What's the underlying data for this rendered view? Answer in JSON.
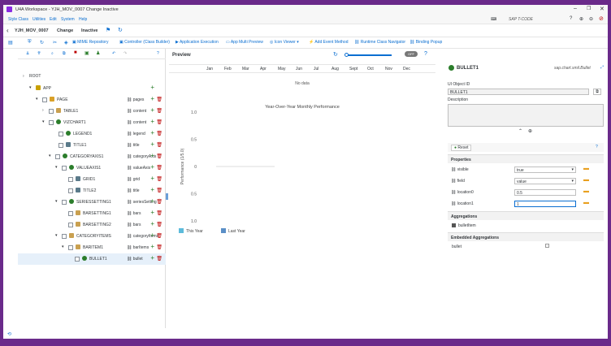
{
  "app": {
    "title": "U4A Workspace - YJH_MOV_0007 Change Inactive"
  },
  "menu": [
    "Style Class",
    "Utilities",
    "Edit",
    "System",
    "Help"
  ],
  "tcode": {
    "label": "SAP T-CODE"
  },
  "header": {
    "app_id": "YJH_MOV_0007",
    "mode": "Change",
    "status": "Inactive"
  },
  "toolbar": {
    "mime": "MIME Repository",
    "controller": "Controller (Class Builder)",
    "app_exec": "Application Execution",
    "multi": "App Multi Preview",
    "icon_viewer": "Icon Viewer",
    "add_event": "Add Event Method",
    "runtime": "Runtime Class Navigator",
    "binding": "Binding Popup"
  },
  "tree": [
    {
      "label": "ROOT",
      "tag": ""
    },
    {
      "label": "APP",
      "tag": ""
    },
    {
      "label": "PAGE",
      "tag": "pages"
    },
    {
      "label": "TABLE1",
      "tag": "content"
    },
    {
      "label": "VIZCHART1",
      "tag": "content"
    },
    {
      "label": "LEGEND1",
      "tag": "legend"
    },
    {
      "label": "TITLE1",
      "tag": "title"
    },
    {
      "label": "CATEGORYAXIS1",
      "tag": "categoryAxis"
    },
    {
      "label": "VALUEAXIS1",
      "tag": "valueAxis"
    },
    {
      "label": "GRID1",
      "tag": "grid"
    },
    {
      "label": "TITLE2",
      "tag": "title"
    },
    {
      "label": "SERIESSETTING1",
      "tag": "seriesSetting"
    },
    {
      "label": "BARSETTING1",
      "tag": "bars"
    },
    {
      "label": "BARSETTING2",
      "tag": "bars"
    },
    {
      "label": "CATEGORYITEMS",
      "tag": "categoryItems"
    },
    {
      "label": "BARITEM1",
      "tag": "barItems"
    },
    {
      "label": "BULLET1",
      "tag": "bullet"
    }
  ],
  "preview": {
    "title": "Preview",
    "months": [
      "Jan",
      "Feb",
      "Mar",
      "Apr",
      "May",
      "Jun",
      "Jul",
      "Aug",
      "Sept",
      "Oct",
      "Nov",
      "Dec"
    ],
    "nodata": "No data",
    "toggle": "OFF"
  },
  "chart_data": {
    "type": "bar",
    "title": "Year-Over-Year Monthly Performance",
    "ylabel": "Performance (1/5.0)",
    "ticks": [
      "1.0",
      "0.5",
      "0",
      "0.5",
      "1.0"
    ],
    "legend": [
      {
        "name": "This Year",
        "color": "#5dbbdb"
      },
      {
        "name": "Last Year",
        "color": "#5b8fc7"
      }
    ],
    "series": []
  },
  "right": {
    "title": "BULLET1",
    "lib": "sap.chart.smil.Bullet",
    "objid_label": "UI Object ID",
    "objid_value": "BULLET1",
    "desc_label": "Description",
    "reset": "Reset",
    "props_header": "Properties",
    "props": [
      {
        "name": "visible",
        "value": "true",
        "select": true
      },
      {
        "name": "field",
        "value": "value",
        "select": true
      },
      {
        "name": "location0",
        "value": "0.5",
        "select": false
      },
      {
        "name": "location1",
        "value": "1",
        "select": false
      }
    ],
    "agg_header": "Aggregations",
    "agg_item": "bulletItem",
    "emb_header": "Embedded Aggregations",
    "emb_item": "bullet"
  }
}
